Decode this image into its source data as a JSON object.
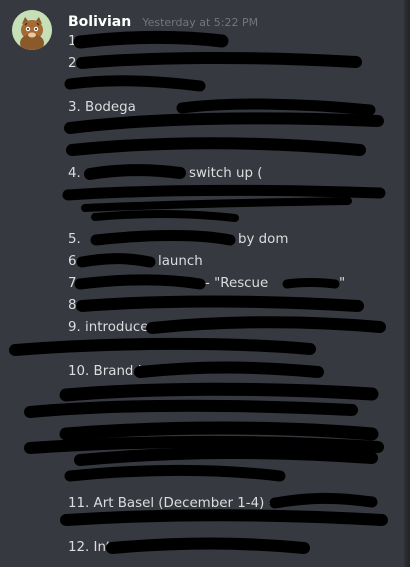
{
  "message": {
    "author": "Bolivian",
    "timestamp": "Yesterday at 5:22 PM",
    "avatar_icon": "tiger-avatar-icon",
    "lines": [
      "1.",
      "2.",
      "3. Bodega",
      "4.",
      "switch up (",
      "5.",
      "by dom",
      "6.",
      "launch",
      "7.",
      "- \"Rescue",
      "\"",
      "8.",
      "9. introduce",
      "10. Brand L",
      "11. Art Basel (December 1-4) -",
      "12. Intro"
    ]
  }
}
